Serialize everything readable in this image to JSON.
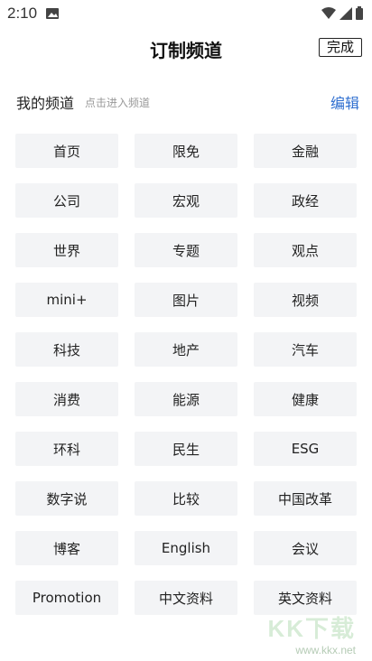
{
  "status_bar": {
    "time": "2:10",
    "icons": [
      "image-icon",
      "wifi-icon",
      "signal-icon",
      "battery-icon"
    ]
  },
  "header": {
    "title": "订制频道",
    "done_label": "完成"
  },
  "section": {
    "title": "我的频道",
    "hint": "点击进入频道",
    "edit_label": "编辑"
  },
  "channels": [
    "首页",
    "限免",
    "金融",
    "公司",
    "宏观",
    "政经",
    "世界",
    "专题",
    "观点",
    "mini+",
    "图片",
    "视频",
    "科技",
    "地产",
    "汽车",
    "消费",
    "能源",
    "健康",
    "环科",
    "民生",
    "ESG",
    "数字说",
    "比较",
    "中国改革",
    "博客",
    "English",
    "会议",
    "Promotion",
    "中文资料",
    "英文资料"
  ],
  "watermark": {
    "big": "KK下载",
    "small": "www.kkx.net"
  },
  "colors": {
    "accent": "#2f6fd0",
    "chip_bg": "#f3f4f6"
  }
}
